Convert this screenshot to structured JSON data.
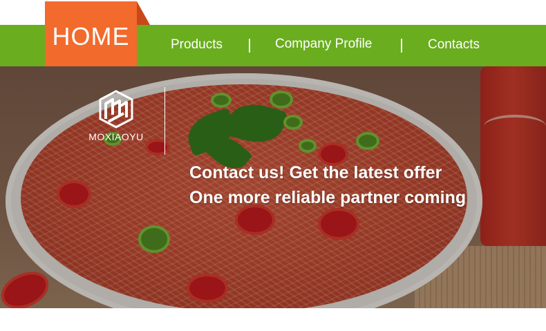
{
  "header": {
    "home_label": "HOME",
    "nav": {
      "products": "Products",
      "company_profile": "Company Profile",
      "contacts": "Contacts"
    }
  },
  "banner": {
    "brand": {
      "name": "MOXIAOYU",
      "logo_icon": "moxiaoyu-logo-icon"
    },
    "headline_1": "Contact us! Get the latest offer",
    "headline_2": "One more reliable partner coming",
    "background_image": "bowl-of-konjac-noodles-in-chili-broth"
  },
  "colors": {
    "nav_green": "#6aad1f",
    "home_orange": "#f26a2c",
    "text_white": "#ffffff"
  }
}
